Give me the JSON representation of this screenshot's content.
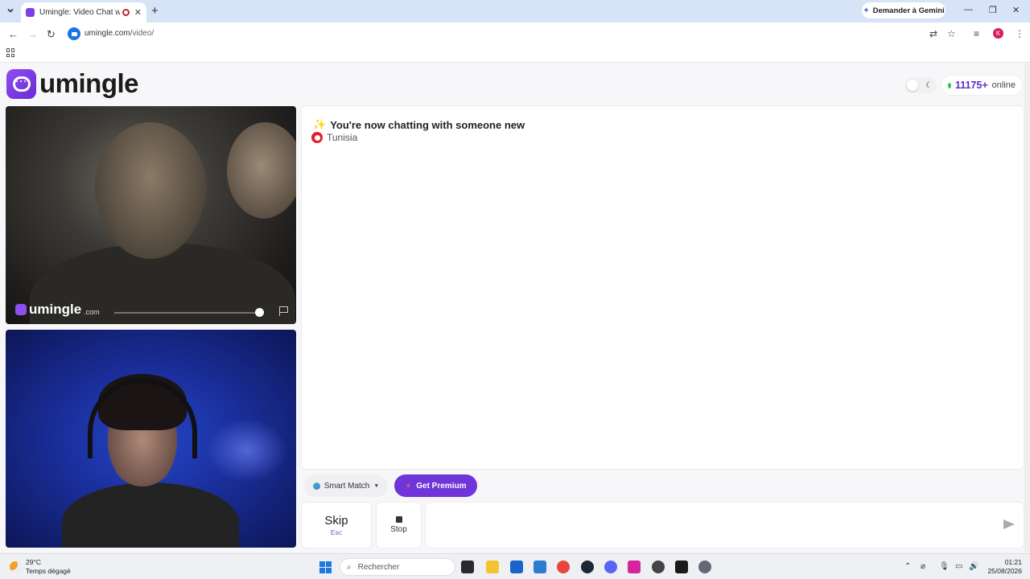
{
  "browser": {
    "tab_title": "Umingle: Video Chat with S",
    "new_tab_icon": "plus-icon",
    "gemini_label": "Demander à Gemini",
    "url_host": "umingle.com",
    "url_path": "/video/",
    "profile_initial": "K"
  },
  "header": {
    "logo_text": "umingle",
    "online_count": "11175+",
    "online_label": "online"
  },
  "remote_video": {
    "watermark_text": "umingle",
    "watermark_suffix": ".com"
  },
  "chat": {
    "status_message": "You're now chatting with someone new",
    "country": "Tunisia",
    "input_value": ""
  },
  "controls": {
    "smart_match_label": "Smart Match",
    "premium_label": "Get Premium",
    "skip_label": "Skip",
    "skip_key": "Esc",
    "stop_label": "Stop"
  },
  "taskbar": {
    "temperature": "29°C",
    "weather_desc": "Temps dégagé",
    "search_label": "Rechercher",
    "time": "01:21",
    "date": "25/08/2026"
  },
  "colors": {
    "brand": "#6f35d8",
    "online_dot": "#2ecc40",
    "accent_count": "#5b2bc7"
  }
}
